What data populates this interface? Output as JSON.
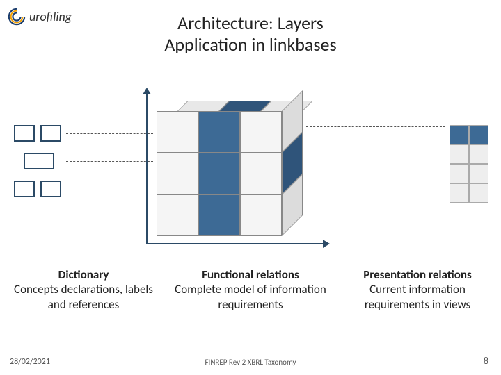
{
  "logo_text": "urofiling",
  "title_line1": "Architecture: Layers",
  "title_line2": "Application in linkbases",
  "captions": {
    "dict_title": "Dictionary",
    "dict_sub": "Concepts declarations, labels and references",
    "func_title": "Functional relations",
    "func_sub": "Complete model of information requirements",
    "pres_title": "Presentation relations",
    "pres_sub": "Current information requirements in views"
  },
  "footer": {
    "date": "28/02/2021",
    "center": "FINREP Rev 2 XBRL Taxonomy",
    "page": "8"
  },
  "chart_data": {
    "type": "diagram",
    "description": "Three-layer architecture diagram connecting Dictionary boxes (left) to a 3x3x3 isometric cube (center, Functional relations) to a 2x4 grid (right, Presentation relations).",
    "cube_front_filled_cells": [
      [
        0,
        1
      ],
      [
        1,
        1
      ],
      [
        2,
        1
      ]
    ],
    "right_grid": {
      "rows": 4,
      "cols": 2,
      "row0_filled": true
    },
    "left_boxes_count": 5,
    "dashed_connectors": 4
  }
}
